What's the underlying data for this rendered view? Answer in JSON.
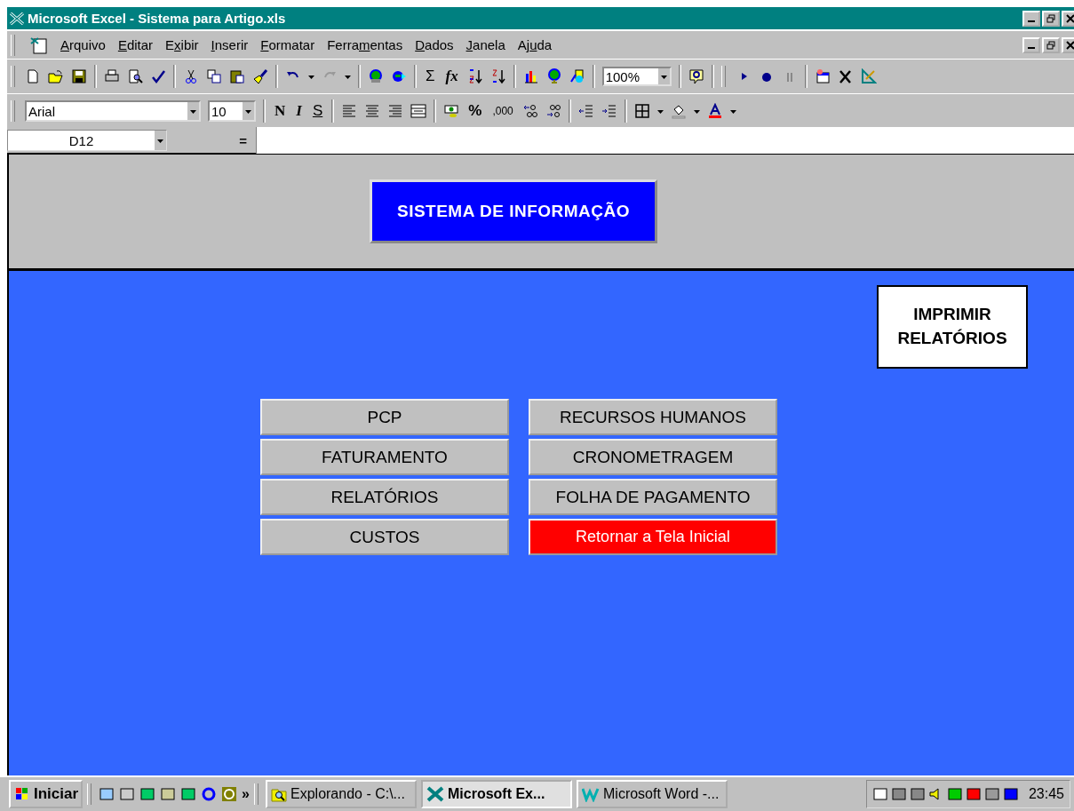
{
  "window": {
    "title": "Microsoft Excel - Sistema para Artigo.xls"
  },
  "menu": [
    {
      "accesskey": "A",
      "suffix": "rquivo"
    },
    {
      "accesskey": "E",
      "suffix": "ditar"
    },
    {
      "prefix": "E",
      "accesskey": "x",
      "suffix": "ibir"
    },
    {
      "accesskey": "I",
      "suffix": "nserir"
    },
    {
      "accesskey": "F",
      "suffix": "ormatar"
    },
    {
      "prefix": "Ferra",
      "accesskey": "m",
      "suffix": "entas"
    },
    {
      "accesskey": "D",
      "suffix": "ados"
    },
    {
      "accesskey": "J",
      "suffix": "anela"
    },
    {
      "prefix": "Aj",
      "accesskey": "u",
      "suffix": "da"
    }
  ],
  "standard_toolbar": {
    "sum": "Σ",
    "function": "fx",
    "zoom": "100%"
  },
  "format_toolbar": {
    "font": "Arial",
    "size": "10",
    "bold": "N",
    "italic": "I",
    "underline": "S",
    "percent": "%",
    "thousands": ",000"
  },
  "formula_bar": {
    "cell": "D12",
    "equals": "="
  },
  "sheet": {
    "header_button": "SISTEMA DE INFORMAÇÃO",
    "print_button": "IMPRIMIR RELATÓRIOS",
    "left_buttons": [
      {
        "label": "PCP",
        "kind": "normal"
      },
      {
        "label": "FATURAMENTO",
        "kind": "normal"
      },
      {
        "label": "RELATÓRIOS",
        "kind": "normal"
      },
      {
        "label": "CUSTOS",
        "kind": "normal"
      }
    ],
    "right_buttons": [
      {
        "label": "RECURSOS HUMANOS",
        "kind": "normal"
      },
      {
        "label": "CRONOMETRAGEM",
        "kind": "normal"
      },
      {
        "label": "FOLHA DE PAGAMENTO",
        "kind": "normal"
      },
      {
        "label": "Retornar a Tela Inicial",
        "kind": "alert"
      }
    ]
  },
  "taskbar": {
    "start": "Iniciar",
    "more": "»",
    "tasks": [
      {
        "label": "Explorando - C:\\...",
        "selected": false
      },
      {
        "label": "Microsoft Ex...",
        "selected": true
      },
      {
        "label": "Microsoft Word -...",
        "selected": false
      }
    ],
    "clock": "23:45"
  }
}
